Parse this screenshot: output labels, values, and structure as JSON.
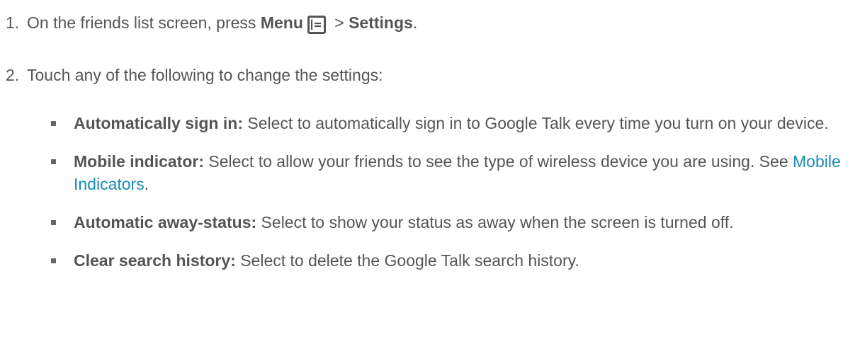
{
  "steps": [
    {
      "number": "1.",
      "text_before": "On the friends list screen, press ",
      "bold1": "Menu",
      "icon": "menu-icon",
      "separator": " > ",
      "bold2": "Settings",
      "text_after": "."
    },
    {
      "number": "2.",
      "text": "Touch any of the following to change the settings:"
    }
  ],
  "bullets": [
    {
      "label": "Automatically sign in:",
      "text": " Select to automatically sign in to Google Talk every time you turn on your device."
    },
    {
      "label": "Mobile indicator:",
      "text": " Select to allow your friends to see the type of wireless device you are using. See ",
      "link": "Mobile Indicators",
      "after": "."
    },
    {
      "label": "Automatic away-status:",
      "text": " Select to show your status as away when the screen is turned off."
    },
    {
      "label": "Clear search history:",
      "text": " Select to delete the Google Talk search history."
    }
  ],
  "colors": {
    "text": "#555555",
    "link": "#1a8bb5"
  }
}
